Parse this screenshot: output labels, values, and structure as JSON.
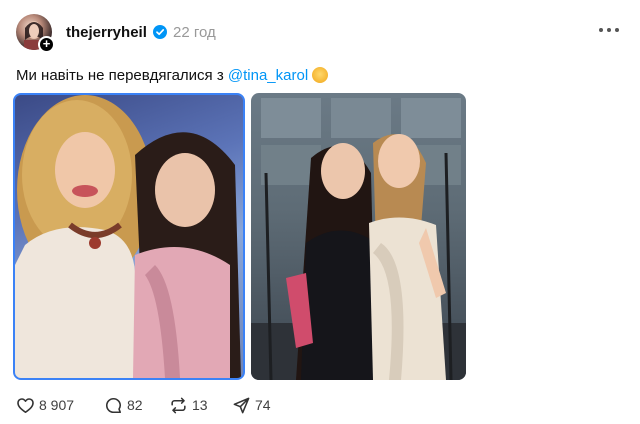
{
  "post": {
    "username": "thejerryheil",
    "timestamp": "22 год",
    "verified": true,
    "caption_text": "Ми навіть не перевдягалися з ",
    "caption_mention": "@tina_karol",
    "caption_emoji": "face-with-hand-over-mouth-emoji"
  },
  "media": {
    "count": 2,
    "images": [
      "vintage-photo",
      "studio-photo"
    ]
  },
  "actions": {
    "likes": "8 907",
    "replies": "82",
    "reposts": "13",
    "shares": "74"
  },
  "colors": {
    "accent": "#0095f6",
    "verified": "#0095f6",
    "muted": "#999999",
    "selection_border": "#3b82f6"
  }
}
